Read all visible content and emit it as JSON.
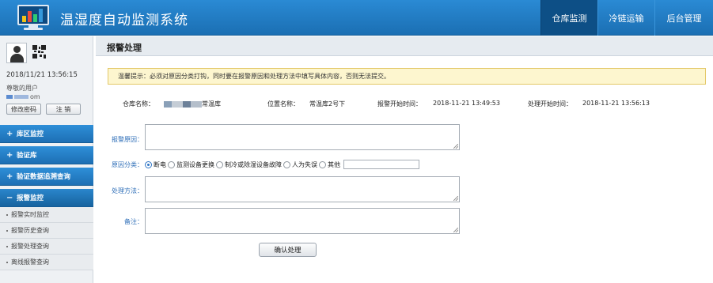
{
  "header": {
    "title": "温湿度自动监测系统",
    "tabs": [
      {
        "label": "仓库监测",
        "active": true
      },
      {
        "label": "冷链运输",
        "active": false
      },
      {
        "label": "后台管理",
        "active": false
      }
    ],
    "colors": {
      "header_bg": "#1b6fb3",
      "active_tab": "#0d4f86"
    }
  },
  "user": {
    "avatar_icon": "user-avatar-icon",
    "qr_icon": "qr-code-icon",
    "datetime": "2018/11/21 13:56:15",
    "greeting": "尊敬的用户",
    "username_suffix": "om",
    "change_password_label": "修改密码",
    "logout_label": "注  销"
  },
  "sidebar": {
    "groups": [
      {
        "sign": "+",
        "label": "库区监控"
      },
      {
        "sign": "+",
        "label": "验证库"
      },
      {
        "sign": "+",
        "label": "验证数据追溯查询"
      },
      {
        "sign": "−",
        "label": "报警监控"
      }
    ],
    "subitems": [
      "报警实时监控",
      "报警历史查询",
      "报警处理查询",
      "离线报警查询"
    ]
  },
  "page": {
    "title": "报警处理",
    "notice": "温馨提示：必须对原因分类打钩，同时要在报警原因和处理方法中填写具体内容，否则无法提交。",
    "info": {
      "warehouse_label": "仓库名称：",
      "warehouse_value_suffix": "常温库",
      "location_label": "位置名称：",
      "location_value": "常温库2号下",
      "alarm_start_label": "报警开始时间：",
      "alarm_start_value": "2018-11-21 13:49:53",
      "handle_start_label": "处理开始时间：",
      "handle_start_value": "2018-11-21 13:56:13"
    },
    "form": {
      "reason_label": "报警原因：",
      "category_label": "原因分类：",
      "categories": [
        "断电",
        "监测设备更换",
        "制冷或除湿设备故障",
        "人为失误",
        "其他"
      ],
      "selected_category": "断电",
      "method_label": "处理方法：",
      "remark_label": "备注：",
      "confirm_label": "确认处理"
    }
  }
}
